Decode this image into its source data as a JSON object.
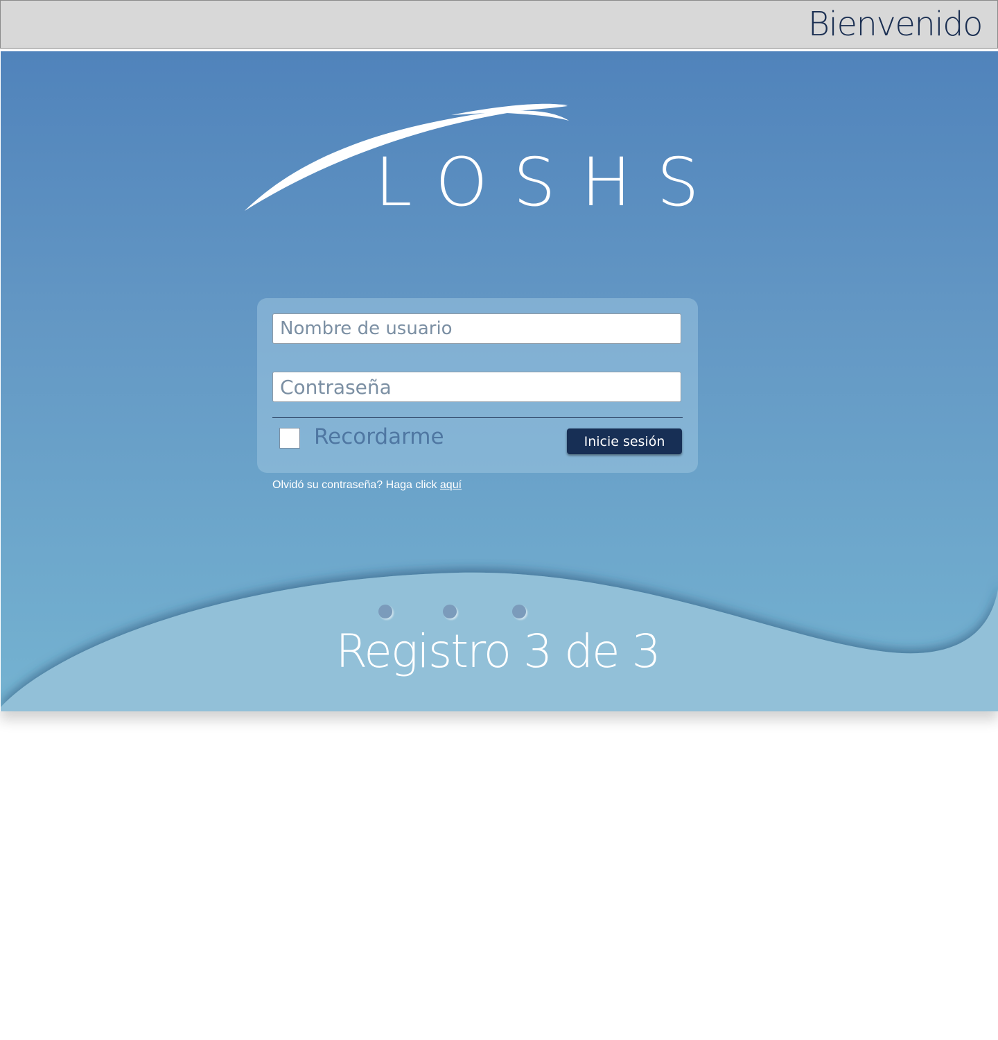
{
  "header": {
    "title": "Bienvenido"
  },
  "logo": {
    "text": "LOSHS"
  },
  "login": {
    "username_placeholder": "Nombre de usuario",
    "password_placeholder": "Contraseña",
    "remember_label": "Recordarme",
    "remember_checked": false,
    "submit_label": "Inicie sesión",
    "forgot_text": "Olvidó su contraseña? Haga click",
    "forgot_link": "aquí"
  },
  "steps": {
    "label": "Registro 3 de 3",
    "current": 3,
    "total": 3
  },
  "colors": {
    "header_bg": "#d8d8d8",
    "title": "#1b2f52",
    "hero_top": "#5083bb",
    "hero_bottom": "#75b3d1",
    "button": "#172f55",
    "wave": "#92c0d8"
  }
}
